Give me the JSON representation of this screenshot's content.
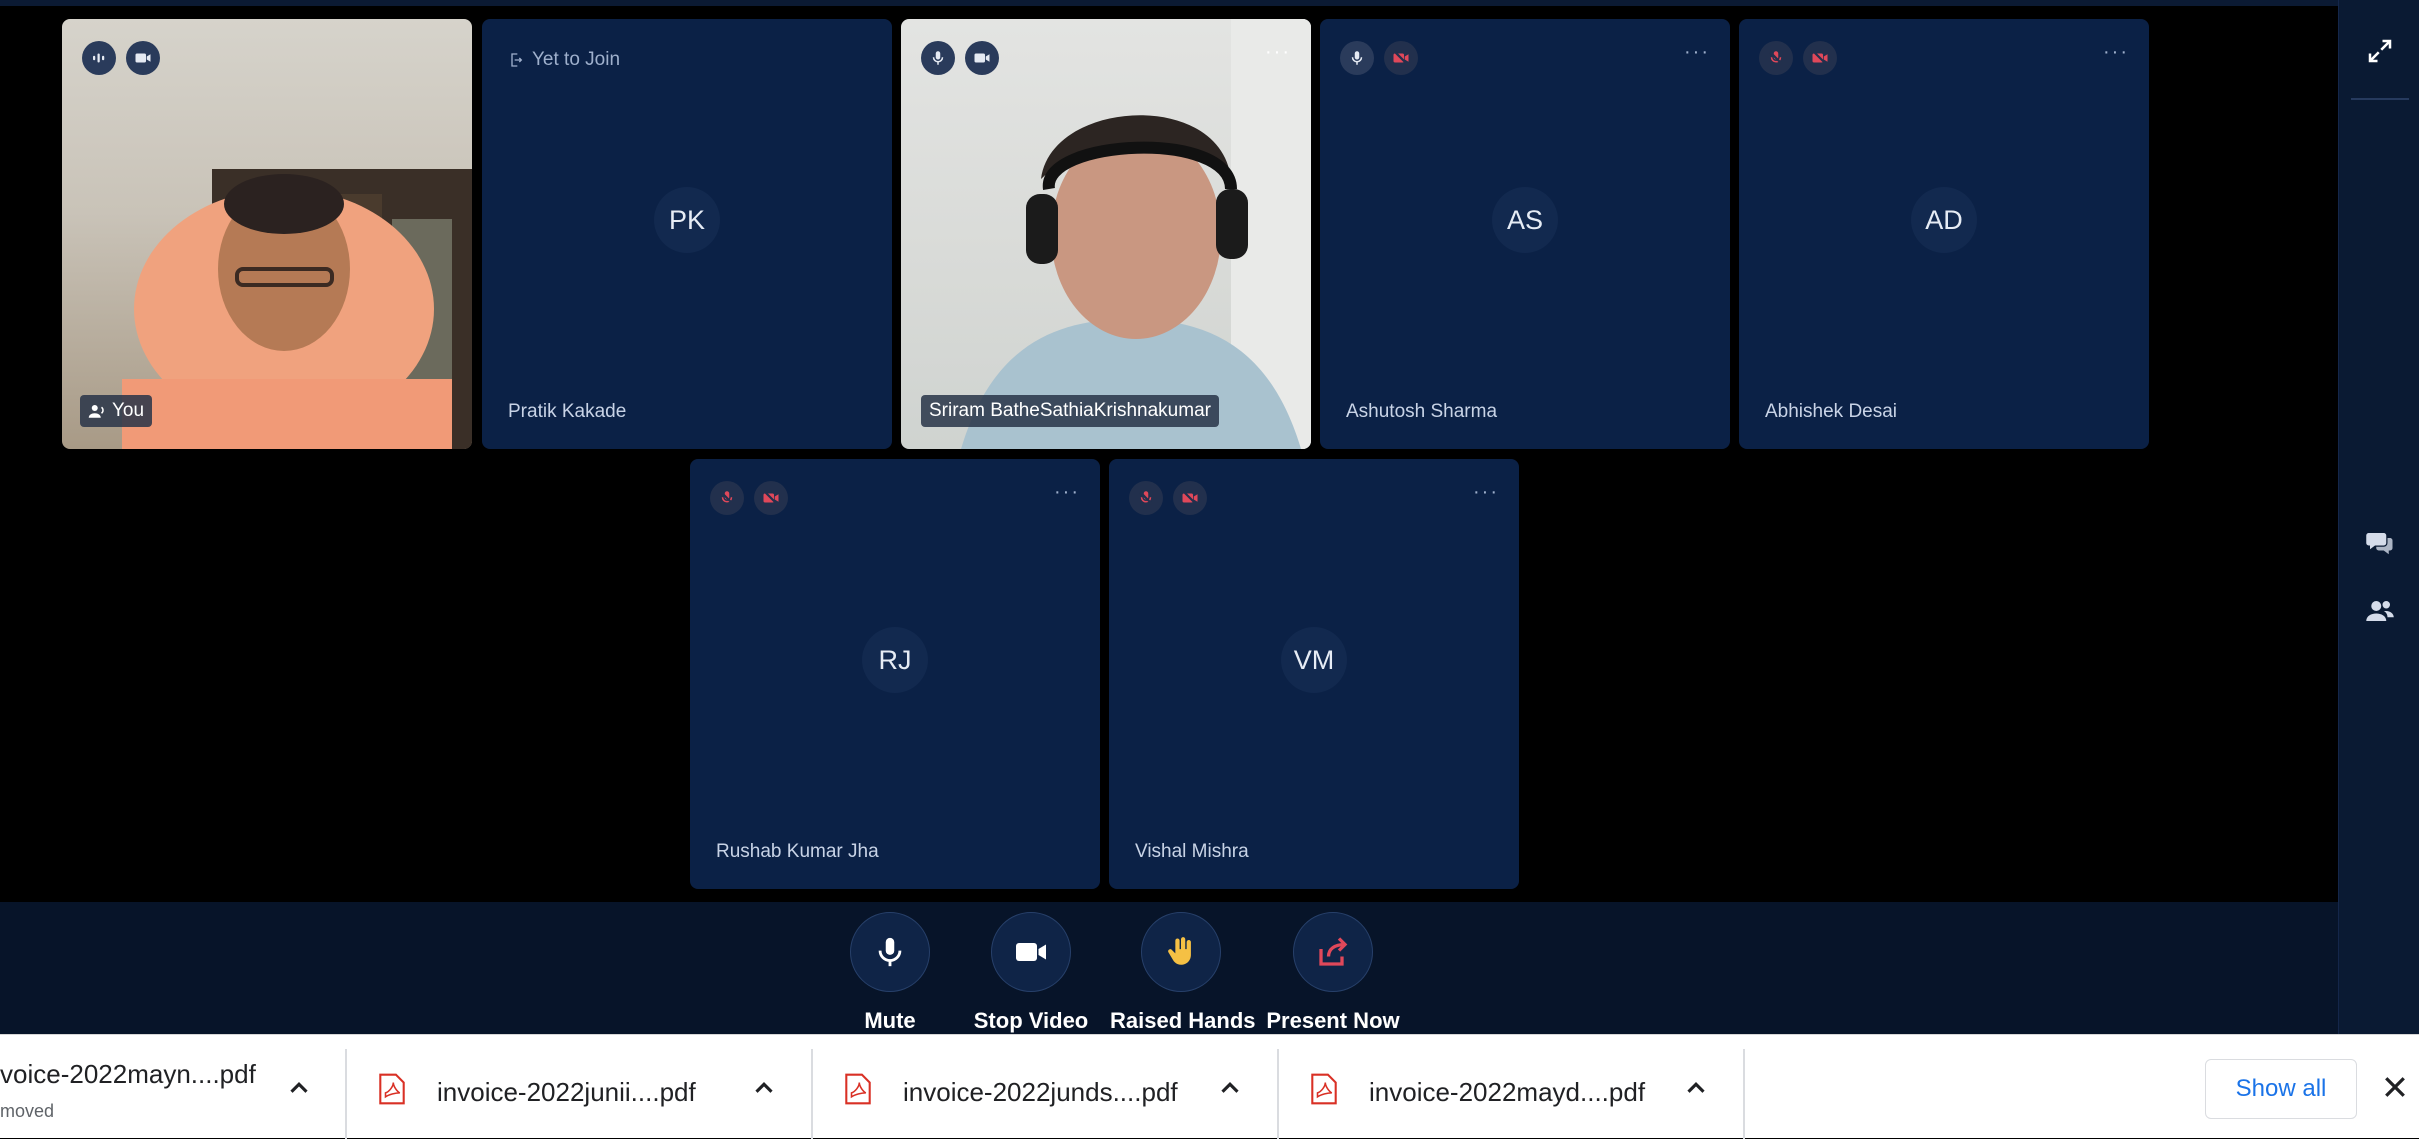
{
  "participants": [
    {
      "name": "You",
      "initials": "",
      "status": "",
      "video": true
    },
    {
      "name": "Pratik Kakade",
      "initials": "PK",
      "status": "Yet to Join",
      "video": false
    },
    {
      "name": "Sriram BatheSathiaKrishnakumar",
      "initials": "",
      "status": "",
      "video": true
    },
    {
      "name": "Ashutosh Sharma",
      "initials": "AS",
      "status": "",
      "video": false
    },
    {
      "name": "Abhishek Desai",
      "initials": "AD",
      "status": "",
      "video": false
    },
    {
      "name": "Rushab Kumar Jha",
      "initials": "RJ",
      "status": "",
      "video": false
    },
    {
      "name": "Vishal Mishra",
      "initials": "VM",
      "status": "",
      "video": false
    }
  ],
  "tile_menu": "···",
  "controls": {
    "mute": "Mute",
    "stop_video": "Stop Video",
    "raised_hands": "Raised Hands",
    "present_now": "Present Now"
  },
  "downloads": [
    {
      "name": "voice-2022mayn....pdf",
      "sub": "moved"
    },
    {
      "name": "invoice-2022junii....pdf",
      "sub": ""
    },
    {
      "name": "invoice-2022junds....pdf",
      "sub": ""
    },
    {
      "name": "invoice-2022mayd....pdf",
      "sub": ""
    }
  ],
  "show_all": "Show all",
  "colors": {
    "tile": "#0b2146",
    "accent_red": "#e0485a",
    "link": "#1a73e8"
  }
}
